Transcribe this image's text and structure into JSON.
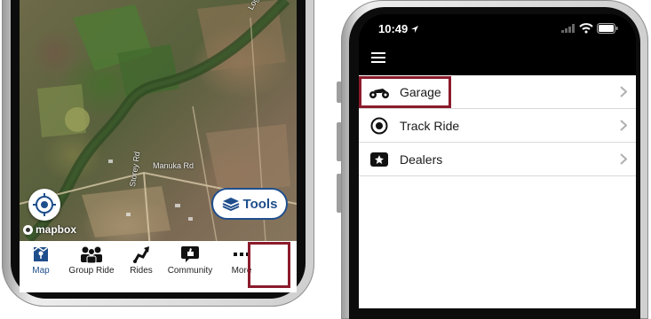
{
  "left_phone": {
    "map": {
      "road_labels": [
        "Manuka Rd",
        "Storey Rd",
        "Logan Rive"
      ],
      "attribution": "mapbox"
    },
    "locate_button": {
      "icon": "crosshair-icon"
    },
    "tools_button": {
      "label": "Tools",
      "icon": "layers-icon"
    },
    "tabs": [
      {
        "label": "Map",
        "icon": "map-icon",
        "active": true
      },
      {
        "label": "Group Ride",
        "icon": "group-icon"
      },
      {
        "label": "Rides",
        "icon": "route-icon"
      },
      {
        "label": "Community",
        "icon": "thumbs-up-icon"
      },
      {
        "label": "More",
        "icon": "ellipsis-icon"
      }
    ]
  },
  "right_phone": {
    "status_bar": {
      "time": "10:49"
    },
    "header": {
      "menu_icon": "hamburger-icon"
    },
    "menu_items": [
      {
        "label": "Garage",
        "icon": "atv-icon"
      },
      {
        "label": "Track Ride",
        "icon": "record-icon"
      },
      {
        "label": "Dealers",
        "icon": "dealer-icon"
      }
    ]
  },
  "colors": {
    "highlight": "#8b1b2c",
    "accent": "#1f4e8c"
  }
}
